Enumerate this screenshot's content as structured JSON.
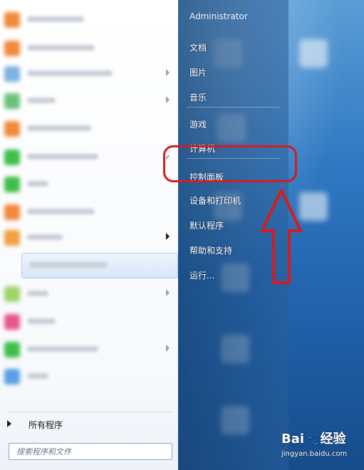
{
  "user": {
    "name": "Administrator"
  },
  "right_menu": {
    "items": [
      {
        "label": "文档",
        "name": "menu-item-documents"
      },
      {
        "label": "图片",
        "name": "menu-item-pictures"
      },
      {
        "label": "音乐",
        "name": "menu-item-music"
      },
      {
        "label": "游戏",
        "name": "menu-item-games"
      },
      {
        "label": "计算机",
        "name": "menu-item-computer"
      },
      {
        "label": "控制面板",
        "name": "menu-item-control-panel"
      },
      {
        "label": "设备和打印机",
        "name": "menu-item-devices-printers"
      },
      {
        "label": "默认程序",
        "name": "menu-item-default-programs"
      },
      {
        "label": "帮助和支持",
        "name": "menu-item-help-support"
      },
      {
        "label": "运行...",
        "name": "menu-item-run"
      }
    ]
  },
  "left_menu": {
    "all_programs": "所有程序"
  },
  "search": {
    "placeholder": "搜索程序和文件"
  },
  "watermark": {
    "logo_a": "Bai",
    "logo_b": "经验",
    "url": "jingyan.baidu.com"
  },
  "colors": {
    "annotation": "#d61c1c"
  },
  "annotation": {
    "highlighted_item": "控制面板"
  }
}
